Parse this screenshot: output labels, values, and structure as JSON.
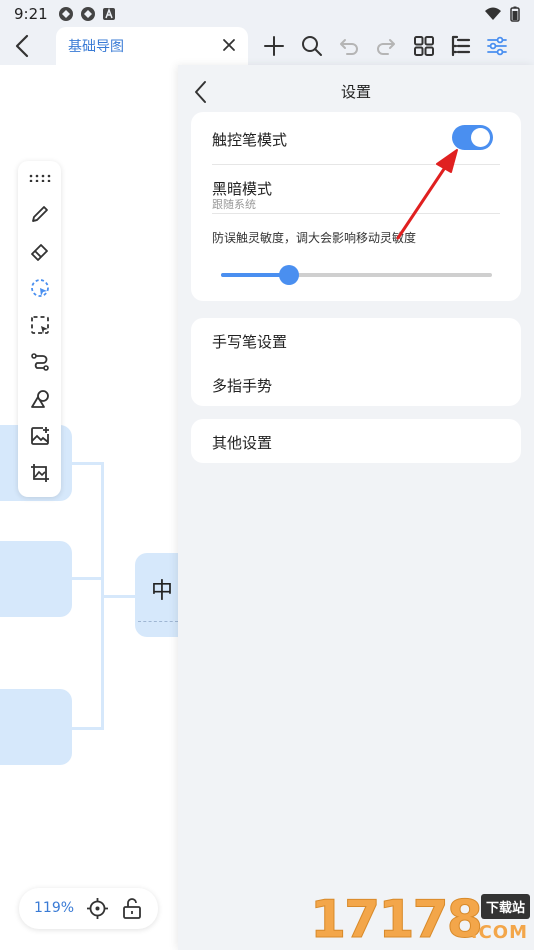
{
  "status_bar": {
    "time": "9:21"
  },
  "toolbar": {
    "tab_title": "基础导图"
  },
  "canvas": {
    "center_node_text": "中",
    "zoom_level": "119%"
  },
  "settings": {
    "title": "设置",
    "stylus_mode": {
      "label": "触控笔模式",
      "enabled": true
    },
    "dark_mode": {
      "label": "黑暗模式",
      "value": "跟随系统"
    },
    "sensitivity": {
      "hint": "防误触灵敏度，调大会影响移动灵敏度",
      "value": 0.25
    },
    "menu": [
      {
        "label": "手写笔设置"
      },
      {
        "label": "多指手势"
      }
    ],
    "other": {
      "label": "其他设置"
    }
  },
  "watermark": {
    "digits": "17178",
    "badge": "下载站",
    "domain": ".COM"
  },
  "colors": {
    "accent": "#4a8ff0",
    "node": "#d6e8fb",
    "arrow": "#e02020"
  }
}
